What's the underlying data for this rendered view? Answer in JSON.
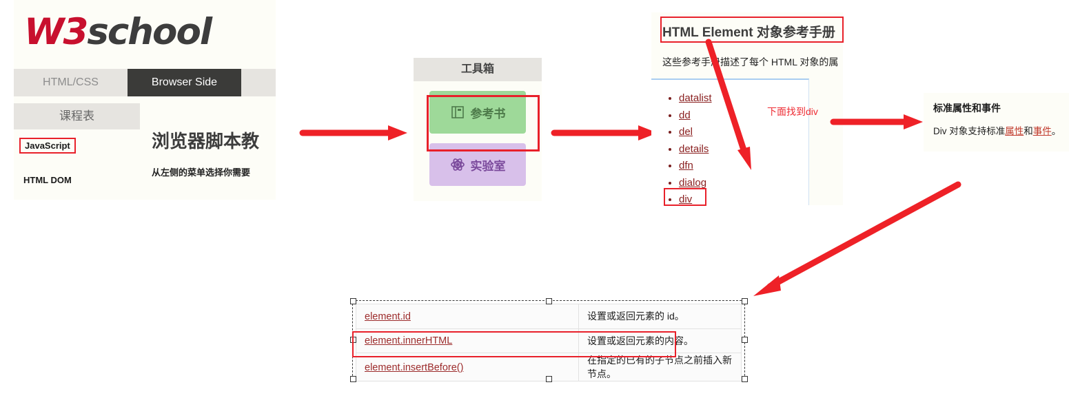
{
  "colors": {
    "arrow_red": "#ee2127",
    "highlight_red": "#e8202a",
    "brand_red": "#c8102e",
    "tab_active_bg": "#3b3b39",
    "panel_bg": "#fdfdf7",
    "green_button": "#9ed999",
    "purple_button": "#d8c0ea",
    "link_red": "#9c2b2b"
  },
  "w3school": {
    "logo": {
      "part1": "W3",
      "part2": "school"
    },
    "tabs": [
      {
        "label": "HTML/CSS",
        "active": false
      },
      {
        "label": "Browser Side",
        "active": true
      }
    ],
    "sidebar": {
      "header": "课程表",
      "items": [
        {
          "label": "JavaScript",
          "highlighted": true
        },
        {
          "label": "HTML DOM",
          "highlighted": false
        }
      ]
    },
    "content": {
      "heading": "浏览器脚本教",
      "paragraph": "从左侧的菜单选择你需要"
    }
  },
  "toolbox": {
    "header": "工具箱",
    "buttons": [
      {
        "label": "参考书",
        "icon": "book-icon",
        "highlighted": true
      },
      {
        "label": "实验室",
        "icon": "atom-icon",
        "highlighted": false
      }
    ]
  },
  "reference": {
    "title": "HTML Element 对象参考手册",
    "description": "这些参考手册描述了每个 HTML 对象的属",
    "note": "下面找到div",
    "list": [
      {
        "label": "datalist",
        "highlighted": false
      },
      {
        "label": "dd",
        "highlighted": false
      },
      {
        "label": "del",
        "highlighted": false
      },
      {
        "label": "details",
        "highlighted": false
      },
      {
        "label": "dfn",
        "highlighted": false
      },
      {
        "label": "dialog",
        "highlighted": false
      },
      {
        "label": "div",
        "highlighted": true
      }
    ]
  },
  "attributes_panel": {
    "heading": "标准属性和事件",
    "text_before": "Div 对象支持标准",
    "link1": "属性",
    "text_middle": "和",
    "link2": "事件",
    "text_after": "。"
  },
  "methods_table": {
    "rows": [
      {
        "name": "element.id",
        "description": "设置或返回元素的 id。",
        "highlighted": false
      },
      {
        "name": "element.innerHTML",
        "description": "设置或返回元素的内容。",
        "highlighted": true
      },
      {
        "name": "element.insertBefore()",
        "description": "在指定的已有的子节点之前插入新节点。",
        "highlighted": false
      }
    ]
  }
}
